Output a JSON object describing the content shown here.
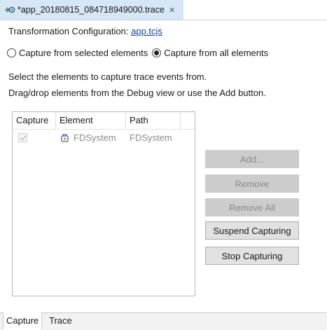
{
  "editor_tab": {
    "title": "*app_20180815_084718949000.trace",
    "close_glyph": "✕",
    "icon": "trace-file-icon",
    "accent": "#d6e6f5"
  },
  "config": {
    "label": "Transformation Configuration:",
    "link": "app.tcjs"
  },
  "capture_mode": {
    "options": [
      {
        "label": "Capture from selected elements",
        "checked": false
      },
      {
        "label": "Capture from all elements",
        "checked": true
      }
    ]
  },
  "instructions": {
    "line1": "Select the elements to capture trace events from.",
    "line2": "Drag/drop elements from the Debug view or use the Add button."
  },
  "table": {
    "columns": [
      "Capture",
      "Element",
      "Path"
    ],
    "rows": [
      {
        "capture": true,
        "element": "FDSystem",
        "path": "FDSystem",
        "icon": "capsule-icon"
      }
    ]
  },
  "buttons": {
    "add": {
      "label": "Add...",
      "enabled": false
    },
    "remove": {
      "label": "Remove",
      "enabled": false
    },
    "remove_all": {
      "label": "Remove All",
      "enabled": false
    },
    "suspend": {
      "label": "Suspend Capturing",
      "enabled": true
    },
    "stop": {
      "label": "Stop Capturing",
      "enabled": true
    }
  },
  "page_tabs": {
    "items": [
      {
        "label": "Capture",
        "active": true
      },
      {
        "label": "Trace",
        "active": false
      }
    ]
  }
}
